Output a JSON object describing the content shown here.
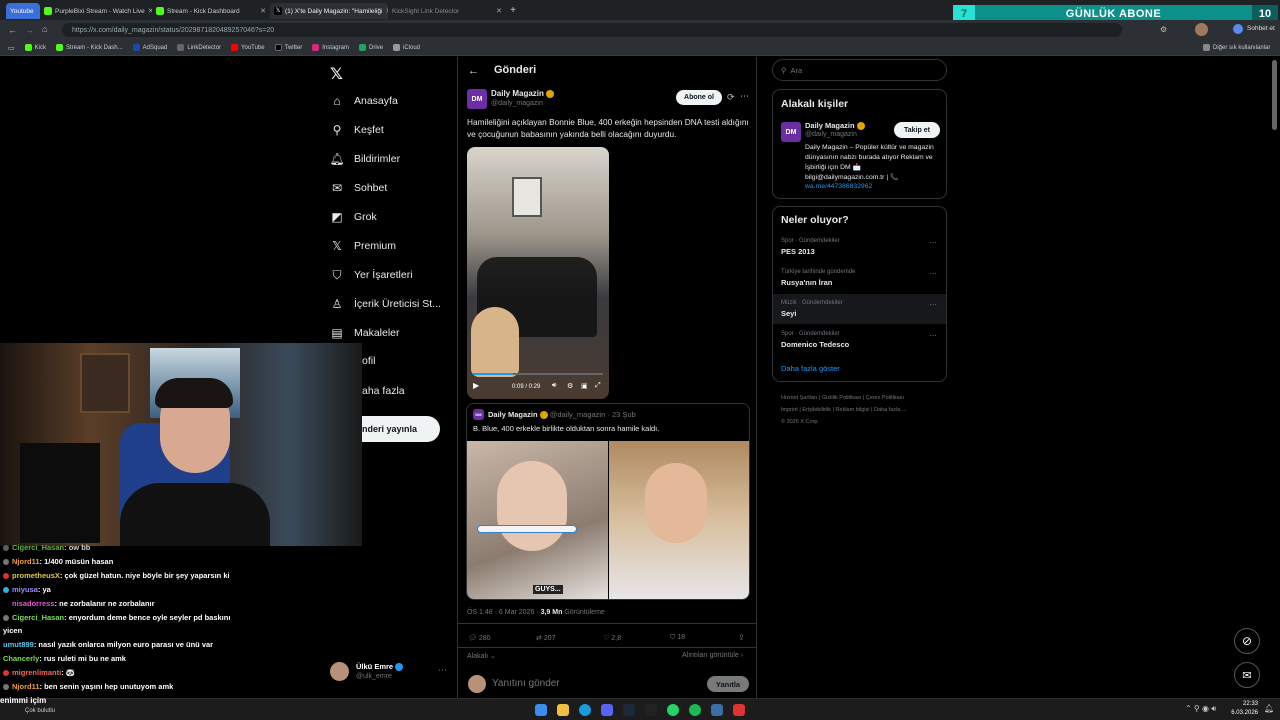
{
  "browser": {
    "tabs": [
      {
        "label": "Youtube"
      },
      {
        "label": "PurpleBixi Stream - Watch Live"
      },
      {
        "label": "Stream - Kick Dashboard"
      },
      {
        "label": "(1) X'te Daily Magazin: \"Hamileliği"
      },
      {
        "label": "KickSight Link Detector"
      }
    ],
    "url": "https://x.com/daily_magazin/status/2029871820489257046?s=20",
    "profile_label": "Sohbet et",
    "bookmarks": [
      "Kick",
      "Stream - Kick Dash...",
      "AdSquad",
      "LinkDetector",
      "YouTube",
      "Twitter",
      "Instagram",
      "Drive",
      "iCloud"
    ],
    "bookmarks_other": "Diğer sık kullanılanlar"
  },
  "overlay": {
    "left_number": "7",
    "title": "GÜNLÜK ABONE",
    "right_number": "10"
  },
  "sidebar": {
    "items": [
      {
        "label": "Anasayfa",
        "icon": "home-icon"
      },
      {
        "label": "Keşfet",
        "icon": "search-icon"
      },
      {
        "label": "Bildirimler",
        "icon": "bell-icon"
      },
      {
        "label": "Sohbet",
        "icon": "mail-icon"
      },
      {
        "label": "Grok",
        "icon": "grok-icon"
      },
      {
        "label": "Premium",
        "icon": "x-premium-icon"
      },
      {
        "label": "Yer İşaretleri",
        "icon": "bookmark-icon"
      },
      {
        "label": "İçerik Üreticisi St...",
        "icon": "creator-icon"
      },
      {
        "label": "Makaleler",
        "icon": "article-icon"
      },
      {
        "label": "ofil",
        "icon": "profile-icon"
      },
      {
        "label": "aha fazla",
        "icon": "more-icon"
      }
    ],
    "post_button": "nderi yayınla",
    "account": {
      "name": "Ülkü Emre",
      "handle": "@ulk_emre"
    }
  },
  "post": {
    "header": "Gönderi",
    "author": {
      "name": "Daily Magazin",
      "handle": "@daily_magazin",
      "avatar": "DM"
    },
    "subscribe": "Abone ol",
    "text": "Hamileliğini açıklayan Bonnie Blue, 400 erkeğin hepsinden DNA testi aldığını ve çocuğunun babasının yakında belli olacağını duyurdu.",
    "video_time": "0:09 / 0:29",
    "quote": {
      "name": "Daily Magazin",
      "handle": "@daily_magazin",
      "date": "23 Şub",
      "text": "B. Blue, 400 erkekle birlikte olduktan sonra hamile kaldı.",
      "caption": "GUYS..."
    },
    "meta": {
      "time": "ÖS 1:48",
      "date": "6 Mar 2026",
      "views": "3,9 Mn",
      "views_label": "Görüntüleme"
    },
    "stats": {
      "replies": "280",
      "reposts": "207",
      "likes": "2,8",
      "bookmarks": "18"
    },
    "relevance": "Alakalı",
    "quotes_link": "Alıntıları görüntüle",
    "reply_placeholder": "Yanıtını gönder",
    "reply_button": "Yanıtla"
  },
  "right": {
    "search_placeholder": "Ara",
    "related_title": "Alakalı kişiler",
    "related": {
      "name": "Daily Magazin",
      "handle": "@daily_magazin",
      "follow": "Takip et",
      "bio": "Daily Magazin – Popüler kültür ve magazin dünyasının nabzı burada atıyor Reklam ve İşbirliği için DM 📩 bilgi@dailymagazin.com.tr | 📞",
      "link": "wa.me/447386832962"
    },
    "trends_title": "Neler oluyor?",
    "trends": [
      {
        "category": "Spor · Gündemdekiler",
        "name": "PES 2013"
      },
      {
        "category": "Türkiye tarihinde gündemde",
        "name": "Rusya'nın İran"
      },
      {
        "category": "Müzik · Gündemdekiler",
        "name": "Seyi"
      },
      {
        "category": "Spor · Gündemdekiler",
        "name": "Domenico Tedesco"
      }
    ],
    "show_more": "Daha fazla göster",
    "footer": [
      "Hizmet Şartları",
      "Gizlilik Politikası",
      "Çerez Politikası",
      "Imprint",
      "Erişilebilirlik",
      "Reklam bilgisi",
      "Daha fazla ...",
      "© 2026 X Corp."
    ]
  },
  "chat": [
    {
      "user": "Cigerci_Hasan",
      "msg": ": ow bb",
      "color": "#7fdc5a"
    },
    {
      "user": "Njord11",
      "msg": ": 1/400 müsün hasan",
      "color": "#f0a030"
    },
    {
      "user": "prometheusX",
      "msg": ": çok güzel hatun. niye böyle bir şey yaparsın ki",
      "color": "#e0c84a"
    },
    {
      "user": "miyusa",
      "msg": ": ya",
      "color": "#9b8cff"
    },
    {
      "user": "nisadorress",
      "msg": ": ne zorbalanır ne zorbalanır",
      "color": "#e05ad0"
    },
    {
      "user": "Cigerci_Hasan",
      "msg": ": enyordum deme bence oyle seyler pd baskını",
      "color": "#7fdc5a"
    },
    {
      "user": "",
      "msg": "yicen",
      "color": "#fff"
    },
    {
      "user": "umut899",
      "msg": ": nasıl yazık onlarca milyon euro parası ve ünü var",
      "color": "#5ac8f0"
    },
    {
      "user": "Chancerly",
      "msg": ": rus ruleti mi bu ne amk",
      "color": "#7fdc5a"
    },
    {
      "user": "migrenlimanti",
      "msg": ": 🐼",
      "color": "#f06a5a"
    },
    {
      "user": "Njord11",
      "msg": ": ben senin yaşını hep unutuyom amk",
      "color": "#f0a030"
    }
  ],
  "taskbar": {
    "weather_title": "enimmi içim",
    "weather_sub": "Çok bulutlu",
    "time": "22:33",
    "date": "6.03.2026"
  }
}
